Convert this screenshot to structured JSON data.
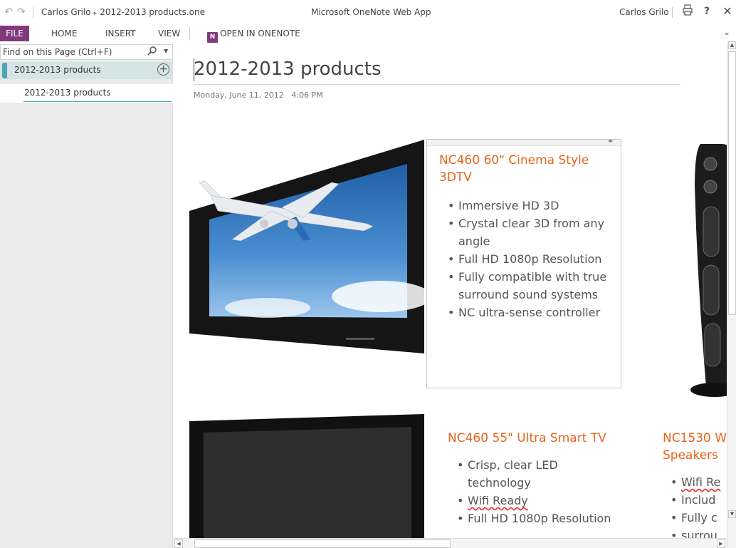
{
  "titlebar": {
    "breadcrumb_owner": "Carlos Grilo",
    "breadcrumb_separator": "▸",
    "breadcrumb_file": "2012-2013 products.one",
    "app_name": "Microsoft OneNote Web App",
    "user_name": "Carlos Grilo",
    "undo_icon": "undo-icon",
    "redo_icon": "redo-icon",
    "print_icon": "printer-icon",
    "help_label": "?",
    "close_label": "✕"
  },
  "ribbon": {
    "tabs": [
      {
        "label": "FILE",
        "active": true,
        "color": "#80397b"
      },
      {
        "label": "HOME"
      },
      {
        "label": "INSERT"
      },
      {
        "label": "VIEW"
      }
    ],
    "open_in_onenote": "OPEN IN ONENOTE",
    "onenote_icon_text": "N",
    "collapse_icon": "chevron-down-icon"
  },
  "left_pane": {
    "find_placeholder": "Find on this Page (Ctrl+F)",
    "sections": [
      {
        "label": "2012-2013 products",
        "color": "#4aa6b3"
      }
    ],
    "pages": [
      {
        "label": "2012-2013 products",
        "selected": true
      }
    ],
    "add_page_icon": "add-circle-icon"
  },
  "page": {
    "title": "2012-2013 products",
    "date": "Monday, June 11, 2012",
    "time": "4:06 PM",
    "products": [
      {
        "title": "NC460 60\" Cinema Style 3DTV",
        "bullets": [
          "Immersive HD 3D",
          "Crystal clear 3D from any angle",
          "Full HD 1080p Resolution",
          "Fully compatible with true surround sound systems",
          "NC ultra-sense controller"
        ]
      },
      {
        "title": "NC460 55\" Ultra Smart TV",
        "bullets": [
          "Crisp, clear LED technology",
          "Wifi Ready",
          "Full HD 1080p Resolution"
        ]
      },
      {
        "title": "NC1530 W Speakers",
        "bullets": [
          "Wifi Re",
          "Includ",
          "Fully c",
          "surrou"
        ]
      }
    ]
  },
  "colors": {
    "accent_purple": "#80397b",
    "section_teal": "#4aa6b3",
    "product_orange": "#e8641b",
    "left_pane_bg": "#ebebeb"
  }
}
